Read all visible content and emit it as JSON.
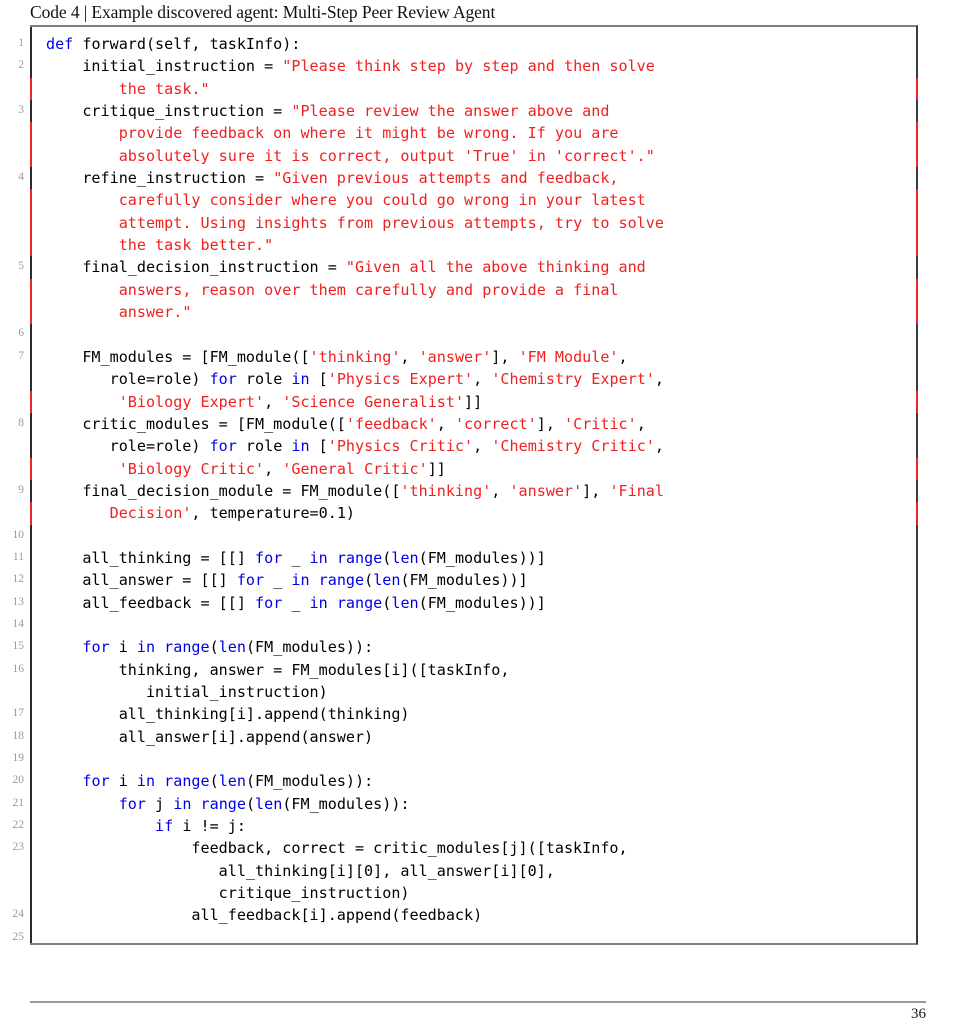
{
  "caption": {
    "label": "Code 4",
    "separator": "|",
    "title": "Example discovered agent: Multi-Step Peer Review Agent",
    "full": "Code 4 | Example discovered agent: Multi-Step Peer Review Agent"
  },
  "colors": {
    "keyword": "#0000e6",
    "string": "#f02020",
    "plain": "#000000",
    "line_number": "#9a9a9a",
    "frame_top_bottom": "#808080",
    "frame_right": "#3a3a3a",
    "frame_left": "#2b2b2b",
    "string_edge": "#e8282a",
    "footer_rule": "#9b9b9b",
    "background": "#ffffff"
  },
  "listing": {
    "language": "python",
    "first_line_number": 1,
    "last_line_number": 25,
    "lines": [
      {
        "n": "1",
        "edge": "black",
        "tokens": [
          {
            "t": "def",
            "c": "k"
          },
          {
            "t": " forward(self, taskInfo):",
            "c": "p"
          }
        ]
      },
      {
        "n": "2",
        "edge": "black",
        "tokens": [
          {
            "t": "    initial_instruction = ",
            "c": "p"
          },
          {
            "t": "\"Please think step by step and then solve",
            "c": "s"
          }
        ]
      },
      {
        "n": "",
        "edge": "red",
        "tokens": [
          {
            "t": "        ",
            "c": "p"
          },
          {
            "t": "the task.\"",
            "c": "s"
          }
        ]
      },
      {
        "n": "3",
        "edge": "black",
        "tokens": [
          {
            "t": "    critique_instruction = ",
            "c": "p"
          },
          {
            "t": "\"Please review the answer above and",
            "c": "s"
          }
        ]
      },
      {
        "n": "",
        "edge": "red",
        "tokens": [
          {
            "t": "        ",
            "c": "p"
          },
          {
            "t": "provide feedback on where it might be wrong. If you are",
            "c": "s"
          }
        ]
      },
      {
        "n": "",
        "edge": "red",
        "tokens": [
          {
            "t": "        ",
            "c": "p"
          },
          {
            "t": "absolutely sure it is correct, output 'True' in 'correct'.\"",
            "c": "s"
          }
        ]
      },
      {
        "n": "4",
        "edge": "black",
        "tokens": [
          {
            "t": "    refine_instruction = ",
            "c": "p"
          },
          {
            "t": "\"Given previous attempts and feedback,",
            "c": "s"
          }
        ]
      },
      {
        "n": "",
        "edge": "red",
        "tokens": [
          {
            "t": "        ",
            "c": "p"
          },
          {
            "t": "carefully consider where you could go wrong in your latest",
            "c": "s"
          }
        ]
      },
      {
        "n": "",
        "edge": "red",
        "tokens": [
          {
            "t": "        ",
            "c": "p"
          },
          {
            "t": "attempt. Using insights from previous attempts, try to solve",
            "c": "s"
          }
        ]
      },
      {
        "n": "",
        "edge": "red",
        "tokens": [
          {
            "t": "        ",
            "c": "p"
          },
          {
            "t": "the task better.\"",
            "c": "s"
          }
        ]
      },
      {
        "n": "5",
        "edge": "black",
        "tokens": [
          {
            "t": "    final_decision_instruction = ",
            "c": "p"
          },
          {
            "t": "\"Given all the above thinking and",
            "c": "s"
          }
        ]
      },
      {
        "n": "",
        "edge": "red",
        "tokens": [
          {
            "t": "        ",
            "c": "p"
          },
          {
            "t": "answers, reason over them carefully and provide a final",
            "c": "s"
          }
        ]
      },
      {
        "n": "",
        "edge": "red",
        "tokens": [
          {
            "t": "        ",
            "c": "p"
          },
          {
            "t": "answer.\"",
            "c": "s"
          }
        ]
      },
      {
        "n": "6",
        "edge": "black",
        "tokens": []
      },
      {
        "n": "7",
        "edge": "black",
        "tokens": [
          {
            "t": "    FM_modules = [FM_module([",
            "c": "p"
          },
          {
            "t": "'thinking'",
            "c": "s"
          },
          {
            "t": ", ",
            "c": "p"
          },
          {
            "t": "'answer'",
            "c": "s"
          },
          {
            "t": "], ",
            "c": "p"
          },
          {
            "t": "'FM Module'",
            "c": "s"
          },
          {
            "t": ",",
            "c": "p"
          }
        ]
      },
      {
        "n": "",
        "edge": "black",
        "tokens": [
          {
            "t": "       role=role) ",
            "c": "p"
          },
          {
            "t": "for",
            "c": "k"
          },
          {
            "t": " role ",
            "c": "p"
          },
          {
            "t": "in",
            "c": "k"
          },
          {
            "t": " [",
            "c": "p"
          },
          {
            "t": "'Physics Expert'",
            "c": "s"
          },
          {
            "t": ", ",
            "c": "p"
          },
          {
            "t": "'Chemistry Expert'",
            "c": "s"
          },
          {
            "t": ",",
            "c": "p"
          }
        ]
      },
      {
        "n": "",
        "edge": "red",
        "tokens": [
          {
            "t": "        ",
            "c": "p"
          },
          {
            "t": "'Biology Expert'",
            "c": "s"
          },
          {
            "t": ", ",
            "c": "p"
          },
          {
            "t": "'Science Generalist'",
            "c": "s"
          },
          {
            "t": "]]",
            "c": "p"
          }
        ]
      },
      {
        "n": "8",
        "edge": "black",
        "tokens": [
          {
            "t": "    critic_modules = [FM_module([",
            "c": "p"
          },
          {
            "t": "'feedback'",
            "c": "s"
          },
          {
            "t": ", ",
            "c": "p"
          },
          {
            "t": "'correct'",
            "c": "s"
          },
          {
            "t": "], ",
            "c": "p"
          },
          {
            "t": "'Critic'",
            "c": "s"
          },
          {
            "t": ",",
            "c": "p"
          }
        ]
      },
      {
        "n": "",
        "edge": "black",
        "tokens": [
          {
            "t": "       role=role) ",
            "c": "p"
          },
          {
            "t": "for",
            "c": "k"
          },
          {
            "t": " role ",
            "c": "p"
          },
          {
            "t": "in",
            "c": "k"
          },
          {
            "t": " [",
            "c": "p"
          },
          {
            "t": "'Physics Critic'",
            "c": "s"
          },
          {
            "t": ", ",
            "c": "p"
          },
          {
            "t": "'Chemistry Critic'",
            "c": "s"
          },
          {
            "t": ",",
            "c": "p"
          }
        ]
      },
      {
        "n": "",
        "edge": "red",
        "tokens": [
          {
            "t": "        ",
            "c": "p"
          },
          {
            "t": "'Biology Critic'",
            "c": "s"
          },
          {
            "t": ", ",
            "c": "p"
          },
          {
            "t": "'General Critic'",
            "c": "s"
          },
          {
            "t": "]]",
            "c": "p"
          }
        ]
      },
      {
        "n": "9",
        "edge": "black",
        "tokens": [
          {
            "t": "    final_decision_module = FM_module([",
            "c": "p"
          },
          {
            "t": "'thinking'",
            "c": "s"
          },
          {
            "t": ", ",
            "c": "p"
          },
          {
            "t": "'answer'",
            "c": "s"
          },
          {
            "t": "], ",
            "c": "p"
          },
          {
            "t": "'Final",
            "c": "s"
          }
        ]
      },
      {
        "n": "",
        "edge": "red",
        "tokens": [
          {
            "t": "       ",
            "c": "p"
          },
          {
            "t": "Decision'",
            "c": "s"
          },
          {
            "t": ", temperature=0.1)",
            "c": "p"
          }
        ]
      },
      {
        "n": "10",
        "edge": "black",
        "tokens": []
      },
      {
        "n": "11",
        "edge": "black",
        "tokens": [
          {
            "t": "    all_thinking = [[] ",
            "c": "p"
          },
          {
            "t": "for",
            "c": "k"
          },
          {
            "t": " _ ",
            "c": "p"
          },
          {
            "t": "in",
            "c": "k"
          },
          {
            "t": " ",
            "c": "p"
          },
          {
            "t": "range",
            "c": "k"
          },
          {
            "t": "(",
            "c": "p"
          },
          {
            "t": "len",
            "c": "k"
          },
          {
            "t": "(FM_modules))]",
            "c": "p"
          }
        ]
      },
      {
        "n": "12",
        "edge": "black",
        "tokens": [
          {
            "t": "    all_answer = [[] ",
            "c": "p"
          },
          {
            "t": "for",
            "c": "k"
          },
          {
            "t": " _ ",
            "c": "p"
          },
          {
            "t": "in",
            "c": "k"
          },
          {
            "t": " ",
            "c": "p"
          },
          {
            "t": "range",
            "c": "k"
          },
          {
            "t": "(",
            "c": "p"
          },
          {
            "t": "len",
            "c": "k"
          },
          {
            "t": "(FM_modules))]",
            "c": "p"
          }
        ]
      },
      {
        "n": "13",
        "edge": "black",
        "tokens": [
          {
            "t": "    all_feedback = [[] ",
            "c": "p"
          },
          {
            "t": "for",
            "c": "k"
          },
          {
            "t": " _ ",
            "c": "p"
          },
          {
            "t": "in",
            "c": "k"
          },
          {
            "t": " ",
            "c": "p"
          },
          {
            "t": "range",
            "c": "k"
          },
          {
            "t": "(",
            "c": "p"
          },
          {
            "t": "len",
            "c": "k"
          },
          {
            "t": "(FM_modules))]",
            "c": "p"
          }
        ]
      },
      {
        "n": "14",
        "edge": "black",
        "tokens": []
      },
      {
        "n": "15",
        "edge": "black",
        "tokens": [
          {
            "t": "    ",
            "c": "p"
          },
          {
            "t": "for",
            "c": "k"
          },
          {
            "t": " i ",
            "c": "p"
          },
          {
            "t": "in",
            "c": "k"
          },
          {
            "t": " ",
            "c": "p"
          },
          {
            "t": "range",
            "c": "k"
          },
          {
            "t": "(",
            "c": "p"
          },
          {
            "t": "len",
            "c": "k"
          },
          {
            "t": "(FM_modules)):",
            "c": "p"
          }
        ]
      },
      {
        "n": "16",
        "edge": "black",
        "tokens": [
          {
            "t": "        thinking, answer = FM_modules[i]([taskInfo,",
            "c": "p"
          }
        ]
      },
      {
        "n": "",
        "edge": "black",
        "tokens": [
          {
            "t": "           initial_instruction)",
            "c": "p"
          }
        ]
      },
      {
        "n": "17",
        "edge": "black",
        "tokens": [
          {
            "t": "        all_thinking[i].append(thinking)",
            "c": "p"
          }
        ]
      },
      {
        "n": "18",
        "edge": "black",
        "tokens": [
          {
            "t": "        all_answer[i].append(answer)",
            "c": "p"
          }
        ]
      },
      {
        "n": "19",
        "edge": "black",
        "tokens": []
      },
      {
        "n": "20",
        "edge": "black",
        "tokens": [
          {
            "t": "    ",
            "c": "p"
          },
          {
            "t": "for",
            "c": "k"
          },
          {
            "t": " i ",
            "c": "p"
          },
          {
            "t": "in",
            "c": "k"
          },
          {
            "t": " ",
            "c": "p"
          },
          {
            "t": "range",
            "c": "k"
          },
          {
            "t": "(",
            "c": "p"
          },
          {
            "t": "len",
            "c": "k"
          },
          {
            "t": "(FM_modules)):",
            "c": "p"
          }
        ]
      },
      {
        "n": "21",
        "edge": "black",
        "tokens": [
          {
            "t": "        ",
            "c": "p"
          },
          {
            "t": "for",
            "c": "k"
          },
          {
            "t": " j ",
            "c": "p"
          },
          {
            "t": "in",
            "c": "k"
          },
          {
            "t": " ",
            "c": "p"
          },
          {
            "t": "range",
            "c": "k"
          },
          {
            "t": "(",
            "c": "p"
          },
          {
            "t": "len",
            "c": "k"
          },
          {
            "t": "(FM_modules)):",
            "c": "p"
          }
        ]
      },
      {
        "n": "22",
        "edge": "black",
        "tokens": [
          {
            "t": "            ",
            "c": "p"
          },
          {
            "t": "if",
            "c": "k"
          },
          {
            "t": " i != j:",
            "c": "p"
          }
        ]
      },
      {
        "n": "23",
        "edge": "black",
        "tokens": [
          {
            "t": "                feedback, correct = critic_modules[j]([taskInfo,",
            "c": "p"
          }
        ]
      },
      {
        "n": "",
        "edge": "black",
        "tokens": [
          {
            "t": "                   all_thinking[i][0], all_answer[i][0],",
            "c": "p"
          }
        ]
      },
      {
        "n": "",
        "edge": "black",
        "tokens": [
          {
            "t": "                   critique_instruction)",
            "c": "p"
          }
        ]
      },
      {
        "n": "24",
        "edge": "black",
        "tokens": [
          {
            "t": "                all_feedback[i].append(feedback)",
            "c": "p"
          }
        ]
      },
      {
        "n": "25",
        "edge": "black",
        "tokens": []
      }
    ]
  },
  "footer": {
    "page_number": "36"
  }
}
